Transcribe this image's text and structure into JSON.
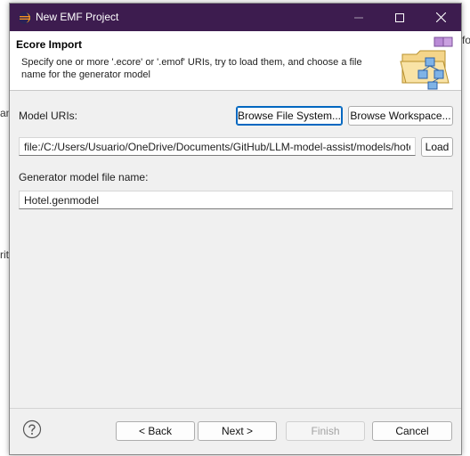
{
  "background": {
    "frag_fo": "fo",
    "frag_am": "am",
    "frag_ri": "rit"
  },
  "window": {
    "title": "New EMF Project"
  },
  "banner": {
    "title": "Ecore Import",
    "description": "Specify one or more '.ecore' or '.emof' URIs, try to load them, and choose a file name for the generator model"
  },
  "form": {
    "model_uris_label": "Model URIs:",
    "browse_fs_label": "Browse File System...",
    "browse_ws_label": "Browse Workspace...",
    "uri_value": "file:/C:/Users/Usuario/OneDrive/Documents/GitHub/LLM-model-assist/models/hotel.ecore",
    "load_label": "Load",
    "genmodel_label": "Generator model file name:",
    "genmodel_value": "Hotel.genmodel"
  },
  "footer": {
    "back_label": "< Back",
    "next_label": "Next >",
    "finish_label": "Finish",
    "cancel_label": "Cancel"
  },
  "colors": {
    "titlebar": "#3d1c4f",
    "focus": "#0067c0"
  },
  "icons": [
    "eclipse-icon",
    "minimize-icon",
    "maximize-icon",
    "close-icon",
    "ecore-import-icon",
    "help-icon"
  ]
}
